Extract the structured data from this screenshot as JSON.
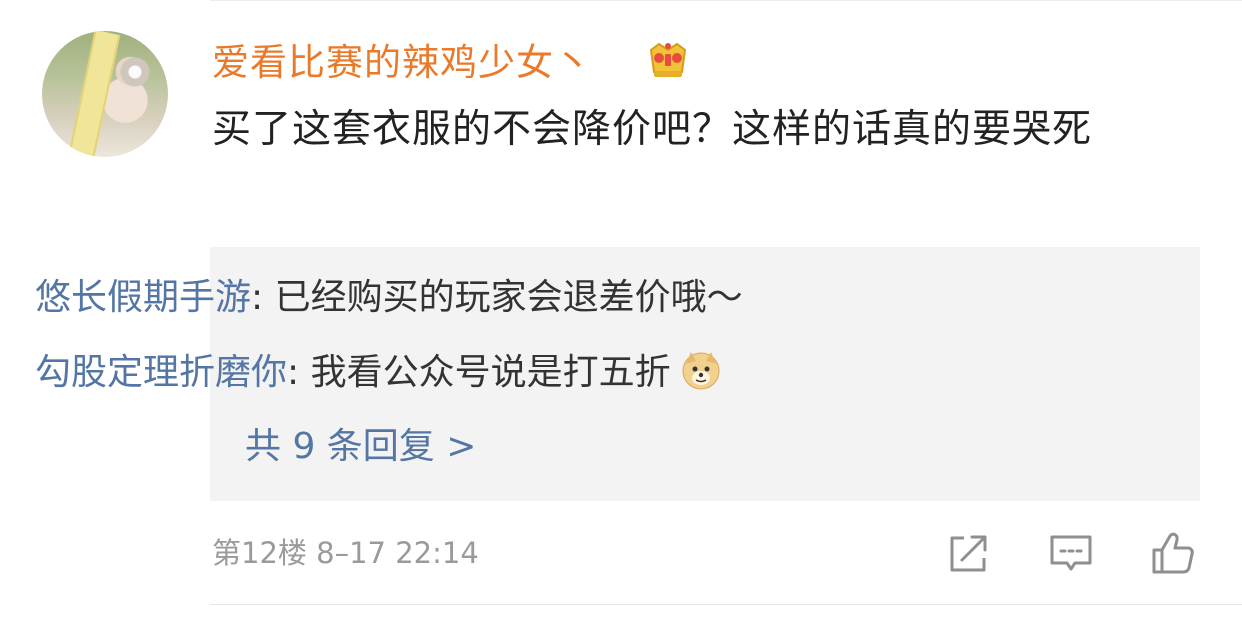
{
  "comment": {
    "username": "爱看比赛的辣鸡少女丶",
    "badge_icon": "crown-icon",
    "text": "买了这套衣服的不会降价吧？这样的话真的要哭死",
    "floor": "第12楼",
    "date": "8–17",
    "time": "22:14"
  },
  "replies": [
    {
      "name": "悠长假期手游",
      "separator": ": ",
      "text": "已经购买的玩家会退差价哦～"
    },
    {
      "name": "勾股定理折磨你",
      "separator": ": ",
      "text": "我看公众号说是打五折",
      "emoji": "doge-emoji"
    }
  ],
  "more_replies": "共 9 条回复 >",
  "actions": [
    {
      "name": "repost",
      "icon": "share-icon"
    },
    {
      "name": "comment",
      "icon": "comment-icon"
    },
    {
      "name": "like",
      "icon": "thumbs-up-icon"
    }
  ],
  "colors": {
    "username": "#ea7a2a",
    "reply_name": "#5476a5",
    "reply_bg": "#f3f3f3",
    "meta": "#9a9a9a"
  }
}
